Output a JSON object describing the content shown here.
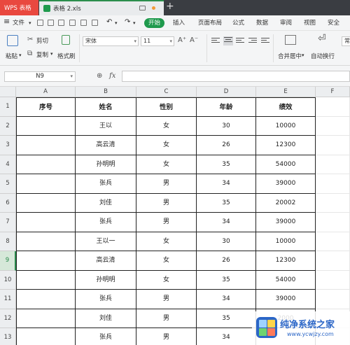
{
  "titlebar": {
    "app_tab": "WPS 表格",
    "file_tab": "表格 2.xls",
    "add_tab": "+"
  },
  "menu": {
    "file": "文件",
    "tabs": [
      "开始",
      "插入",
      "页面布局",
      "公式",
      "数据",
      "审阅",
      "视图",
      "安全"
    ]
  },
  "ribbon": {
    "paste": "粘贴",
    "cut": "剪切",
    "copy": "复制",
    "format_painter": "格式刷",
    "font_name": "宋体",
    "font_size": "11",
    "font_up": "A⁺",
    "font_down": "A⁻",
    "bold": "B",
    "italic": "I",
    "underline": "U",
    "merge_center": "合并居中",
    "wrap_text": "自动换行",
    "more": "常"
  },
  "formula_bar": {
    "name_box": "N9",
    "fx": "fx",
    "formula": ""
  },
  "sheet": {
    "columns": [
      "A",
      "B",
      "C",
      "D",
      "E",
      "F"
    ],
    "rows": [
      "1",
      "2",
      "3",
      "4",
      "5",
      "6",
      "7",
      "8",
      "9",
      "10",
      "11",
      "12",
      "13"
    ],
    "selected_row": "9",
    "header": [
      "序号",
      "姓名",
      "性别",
      "年龄",
      "绩效"
    ],
    "data": [
      [
        "",
        "王以",
        "女",
        "30",
        "10000"
      ],
      [
        "",
        "高云清",
        "女",
        "26",
        "12300"
      ],
      [
        "",
        "孙明明",
        "女",
        "35",
        "54000"
      ],
      [
        "",
        "张兵",
        "男",
        "34",
        "39000"
      ],
      [
        "",
        "刘佳",
        "男",
        "35",
        "20002"
      ],
      [
        "",
        "张兵",
        "男",
        "34",
        "39000"
      ],
      [
        "",
        "王以一",
        "女",
        "30",
        "10000"
      ],
      [
        "",
        "高云清",
        "女",
        "26",
        "12300"
      ],
      [
        "",
        "孙明明",
        "女",
        "35",
        "54000"
      ],
      [
        "",
        "张兵",
        "男",
        "34",
        "39000"
      ],
      [
        "",
        "刘佳",
        "男",
        "35",
        "2000"
      ],
      [
        "",
        "张兵",
        "男",
        "34",
        ""
      ]
    ]
  },
  "watermark": {
    "title": "纯净系统之家",
    "url": "www.ycwjzy.com"
  },
  "colors": {
    "accent_green": "#1f9a4d",
    "wps_red": "#e9483f",
    "watermark_blue": "#2b66c7"
  }
}
